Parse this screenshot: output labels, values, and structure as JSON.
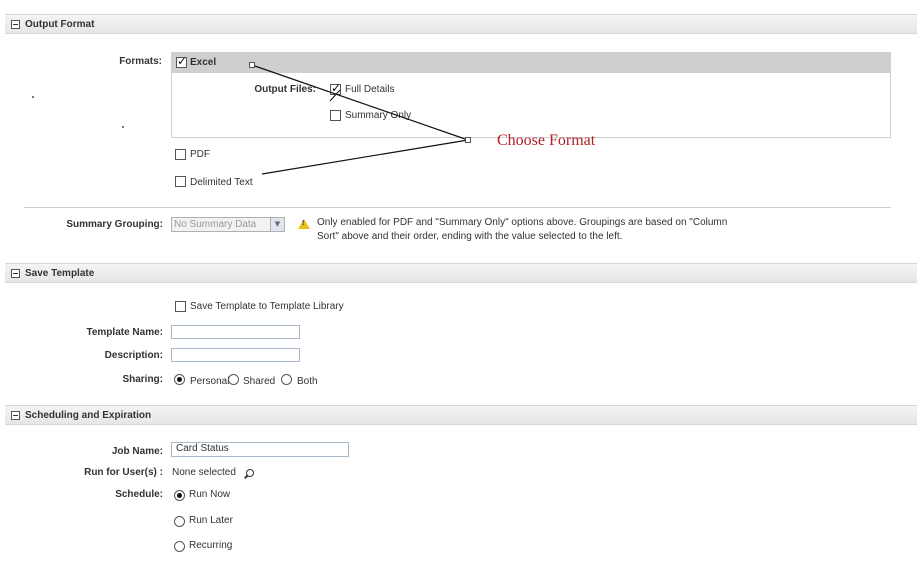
{
  "output_format": {
    "header": "Output Format",
    "formats_label": "Formats:",
    "excel_label": "Excel",
    "output_files_label": "Output Files:",
    "full_details_label": "Full Details",
    "summary_only_label": "Summary Only",
    "pdf_label": "PDF",
    "delimited_label": "Delimited Text",
    "summary_grouping_label": "Summary Grouping:",
    "summary_grouping_value": "No Summary Data",
    "note_line1": "Only enabled for PDF and \"Summary Only\" options above. Groupings are based on \"Column",
    "note_line2": "Sort\" above and their order, ending with the value selected to the left.",
    "callout": "Choose Format"
  },
  "save_template": {
    "header": "Save Template",
    "save_checkbox_label": "Save Template to Template Library",
    "template_name_label": "Template Name:",
    "template_name_value": "",
    "description_label": "Description:",
    "description_value": "",
    "sharing_label": "Sharing:",
    "personal_label": "Personal",
    "shared_label": "Shared",
    "both_label": "Both"
  },
  "scheduling": {
    "header": "Scheduling and Expiration",
    "job_name_label": "Job Name:",
    "job_name_value": "Card Status",
    "run_for_label": "Run for User(s) :",
    "run_for_value": "None selected",
    "schedule_label": "Schedule:",
    "run_now_label": "Run Now",
    "run_later_label": "Run Later",
    "recurring_label": "Recurring"
  },
  "colors": {
    "callout": "#b0202a",
    "excel_row_bg": "#cfcfcf",
    "warning": "#e8c21a"
  },
  "icons": [
    "collapse-icon",
    "checkbox",
    "radio",
    "warning-icon",
    "search-icon",
    "dropdown-arrow-icon"
  ]
}
